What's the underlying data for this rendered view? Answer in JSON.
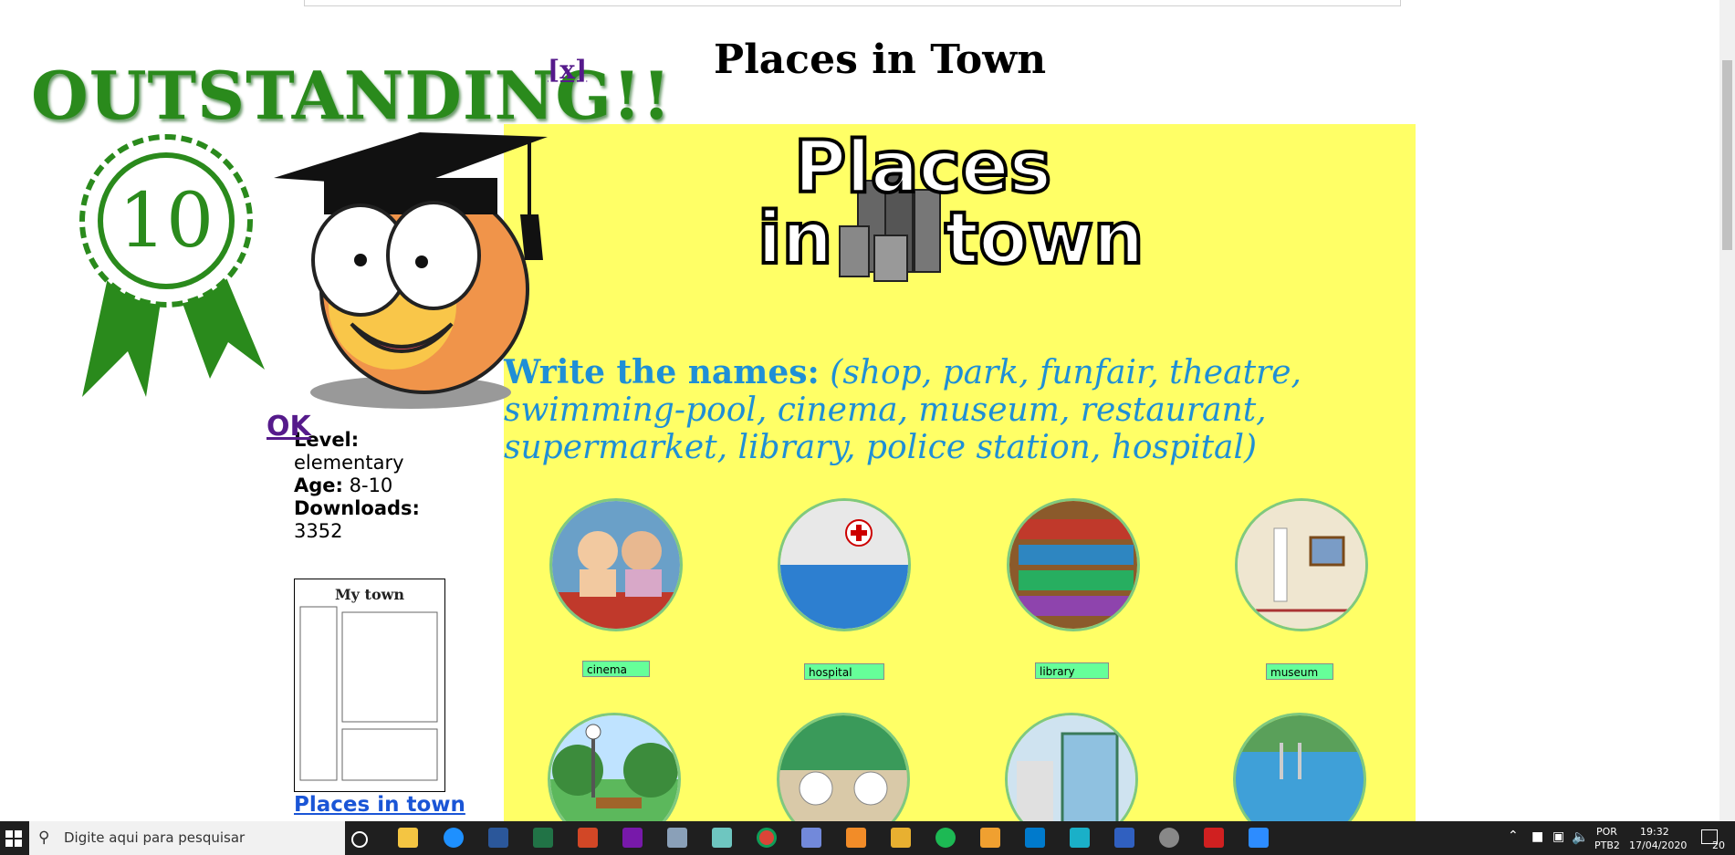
{
  "page": {
    "title": "Places in Town"
  },
  "worksheet": {
    "logo_line1": "Places",
    "logo_line2a": "in",
    "logo_line2b": "town",
    "instructions_bold": "Write the names:",
    "instructions_italic": "(shop, park, funfair, theatre, swimming-pool, cinema, museum, restaurant, supermarket, library, police station, hospital)",
    "answers": [
      "cinema",
      "hospital",
      "library",
      "museum"
    ]
  },
  "left_info": {
    "level_label": "Level:",
    "level_value": "elementary",
    "age_label": "Age:",
    "age_value": "8-10",
    "downloads_label": "Downloads:",
    "downloads_value": "3352",
    "thumbnail_title": "My town",
    "link": "Places in town"
  },
  "overlay": {
    "headline": "OUTSTANDING!!",
    "score": "10",
    "close": "[x]",
    "ok": "OK"
  },
  "taskbar": {
    "search_placeholder": "Digite aqui para pesquisar",
    "lang1": "POR",
    "lang2": "PTB2",
    "time": "19:32",
    "date": "17/04/2020",
    "notifications": "20"
  },
  "colors": {
    "worksheet_bg": "#ffff66",
    "instruction_blue": "#1f8fd6",
    "answer_green": "#66ff99",
    "headline_green": "#2a8a1c",
    "link_purple": "#551a8b"
  },
  "icons": [
    "windows-start-icon",
    "search-icon",
    "task-view-icon",
    "file-explorer-icon",
    "edge-icon",
    "word-icon",
    "excel-icon",
    "powerpoint-icon",
    "onenote-icon",
    "control-panel-icon",
    "sticky-icon",
    "chrome-icon",
    "discord-icon",
    "media-player-icon",
    "paint-icon",
    "spotify-icon",
    "photos-icon",
    "vscode-icon",
    "camera-icon",
    "translator-icon",
    "groove-icon",
    "flash-icon",
    "zoom-icon"
  ]
}
